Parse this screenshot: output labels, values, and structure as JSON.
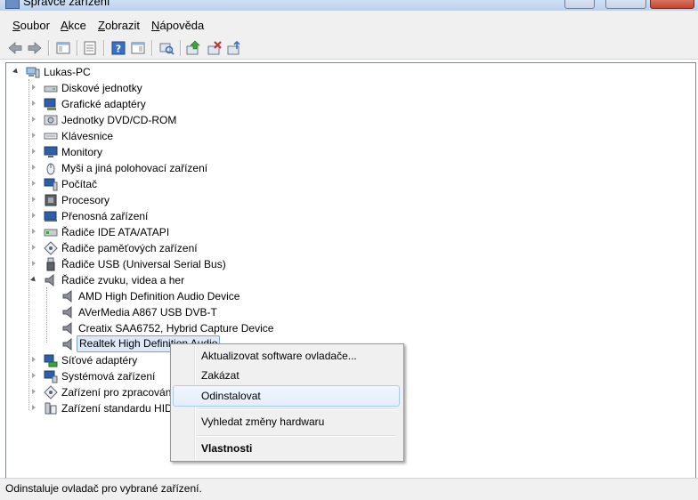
{
  "window": {
    "title": "Správce zařízení"
  },
  "menu": [
    {
      "label": "Soubor",
      "accel": "S",
      "rest": "oubor"
    },
    {
      "label": "Akce",
      "accel": "A",
      "rest": "kce"
    },
    {
      "label": "Zobrazit",
      "accel": "Z",
      "rest": "obrazit"
    },
    {
      "label": "Nápověda",
      "accel": "N",
      "rest": "ápověda"
    }
  ],
  "toolbar": {
    "icons": [
      "back-arrow-icon",
      "forward-arrow-icon",
      "console-tree-icon",
      "properties-icon",
      "help-icon",
      "action-pane-icon",
      "scan-hardware-icon",
      "update-driver-icon",
      "uninstall-icon",
      "disable-device-icon"
    ]
  },
  "tree": {
    "root": "Lukas-PC",
    "categories": [
      {
        "label": "Diskové jednotky"
      },
      {
        "label": "Grafické adaptéry"
      },
      {
        "label": "Jednotky DVD/CD-ROM"
      },
      {
        "label": "Klávesnice"
      },
      {
        "label": "Monitory"
      },
      {
        "label": "Myši a jiná polohovací zařízení"
      },
      {
        "label": "Počítač"
      },
      {
        "label": "Procesory"
      },
      {
        "label": "Přenosná zařízení"
      },
      {
        "label": "Řadiče IDE ATA/ATAPI"
      },
      {
        "label": "Řadiče paměťových zařízení"
      },
      {
        "label": "Řadiče USB (Universal Serial Bus)"
      },
      {
        "label": "Řadiče zvuku, videa a her"
      },
      {
        "label": "Síťové adaptéry"
      },
      {
        "label": "Systémová zařízení"
      },
      {
        "label": "Zařízení pro zpracování"
      },
      {
        "label": "Zařízení standardu HID"
      }
    ],
    "sound_children": [
      "AMD High Definition Audio Device",
      "AVerMedia A867 USB DVB-T",
      "Creatix SAA6752, Hybrid Capture Device",
      "Realtek High Definition Audio"
    ]
  },
  "context_menu": {
    "items": [
      {
        "label": "Aktualizovat software ovladače..."
      },
      {
        "label": "Zakázat"
      },
      {
        "label": "Odinstalovat"
      },
      {
        "label": "Vyhledat změny hardwaru"
      },
      {
        "label": "Vlastnosti"
      }
    ]
  },
  "status": {
    "text": "Odinstaluje ovladač pro vybrané zařízení."
  }
}
